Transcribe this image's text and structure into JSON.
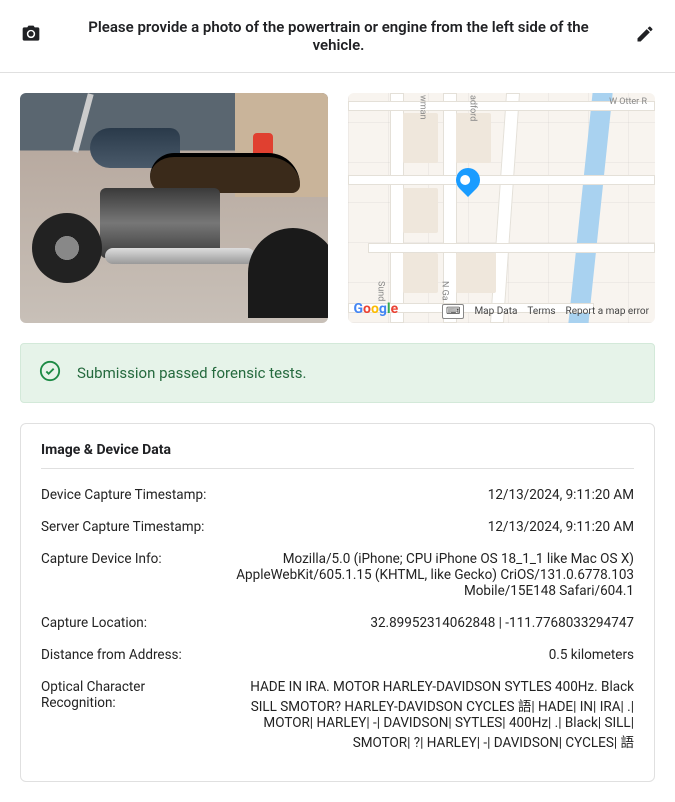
{
  "header": {
    "title": "Please provide a photo of the powertrain or engine from the left side of the vehicle."
  },
  "map": {
    "labels": {
      "otter": "W Otter R",
      "bowman": "wman",
      "bradford": "adford",
      "sund": "Sund",
      "ngar": "N Ga"
    },
    "logo_letters": [
      "G",
      "o",
      "o",
      "g",
      "l",
      "e"
    ],
    "attribution": {
      "mapdata": "Map Data",
      "terms": "Terms",
      "report": "Report a map error"
    }
  },
  "status": {
    "message": "Submission passed forensic tests."
  },
  "info": {
    "heading": "Image & Device Data",
    "rows": [
      {
        "k": "Device Capture Timestamp:",
        "v": "12/13/2024, 9:11:20 AM"
      },
      {
        "k": "Server Capture Timestamp:",
        "v": "12/13/2024, 9:11:20 AM"
      },
      {
        "k": "Capture Device Info:",
        "v": "Mozilla/5.0 (iPhone; CPU iPhone OS 18_1_1 like Mac OS X) AppleWebKit/605.1.15 (KHTML, like Gecko) CriOS/131.0.6778.103 Mobile/15E148 Safari/604.1"
      },
      {
        "k": "Capture Location:",
        "v": "32.89952314062848 | -111.7768033294747"
      },
      {
        "k": "Distance from Address:",
        "v": "0.5 kilometers"
      },
      {
        "k": "Optical Character Recognition:",
        "v": "HADE IN IRA. MOTOR HARLEY-DAVIDSON SYTLES 400Hz. Black SILL SMOTOR? HARLEY-DAVIDSON CYCLES 語| HADE| IN| IRA| .| MOTOR| HARLEY| -| DAVIDSON| SYTLES| 400Hz| .| Black| SILL| SMOTOR| ?| HARLEY| -| DAVIDSON| CYCLES| 語"
      }
    ]
  }
}
